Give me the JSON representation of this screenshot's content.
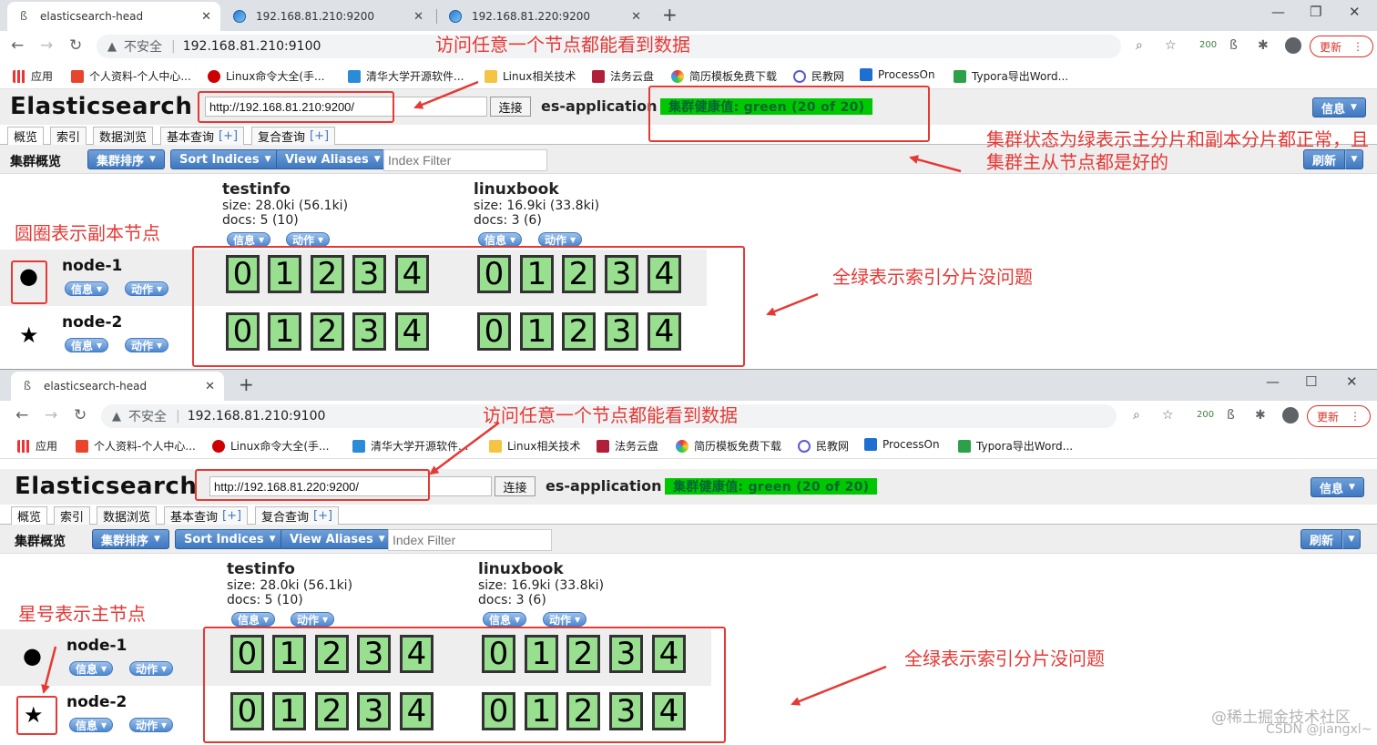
{
  "browser1": {
    "tabs": [
      {
        "title": "elasticsearch-head"
      },
      {
        "title": "192.168.81.210:9200"
      },
      {
        "title": "192.168.81.220:9200"
      }
    ],
    "address": {
      "insecure": "不安全",
      "url": "192.168.81.210:9100"
    },
    "badge": "200",
    "update": "更新"
  },
  "browser2": {
    "tabs": [
      {
        "title": "elasticsearch-head"
      }
    ],
    "address": {
      "insecure": "不安全",
      "url": "192.168.81.210:9100"
    },
    "badge": "200",
    "update": "更新"
  },
  "bookmarks": [
    "应用",
    "个人资料-个人中心...",
    "Linux命令大全(手...",
    "清华大学开源软件...",
    "Linux相关技术",
    "法务云盘",
    "简历模板免费下载",
    "民教网",
    "ProcessOn",
    "Typora导出Word..."
  ],
  "es1": {
    "logo": "Elasticsearch",
    "connect_url": "http://192.168.81.210:9200/",
    "connect_label": "连接",
    "cluster_name": "es-application",
    "health": "集群健康值: green (20 of 20)",
    "info_btn": "信息",
    "tabs": [
      "概览",
      "索引",
      "数据浏览",
      "基本查询",
      "复合查询"
    ],
    "tab_plus": "[+]",
    "sub_title": "集群概览",
    "sort_cluster": "集群排序",
    "sort_indices": "Sort Indices",
    "view_aliases": "View Aliases",
    "index_filter_placeholder": "Index Filter",
    "refresh": "刷新",
    "indices": [
      {
        "name": "testinfo",
        "size": "size: 28.0ki (56.1ki)",
        "docs": "docs: 5 (10)"
      },
      {
        "name": "linuxbook",
        "size": "size: 16.9ki (33.8ki)",
        "docs": "docs: 3 (6)"
      }
    ],
    "info_mini": "信息",
    "action_mini": "动作",
    "nodes": [
      {
        "name": "node-1",
        "icon": "circle-icon",
        "symbol": "●"
      },
      {
        "name": "node-2",
        "icon": "star-icon",
        "symbol": "★"
      }
    ],
    "shards": [
      "0",
      "1",
      "2",
      "3",
      "4"
    ]
  },
  "es2": {
    "logo": "Elasticsearch",
    "connect_url": "http://192.168.81.220:9200/",
    "connect_label": "连接",
    "cluster_name": "es-application",
    "health": "集群健康值: green (20 of 20)",
    "info_btn": "信息",
    "tabs": [
      "概览",
      "索引",
      "数据浏览",
      "基本查询",
      "复合查询"
    ],
    "tab_plus": "[+]",
    "sub_title": "集群概览",
    "sort_cluster": "集群排序",
    "sort_indices": "Sort Indices",
    "view_aliases": "View Aliases",
    "index_filter_placeholder": "Index Filter",
    "refresh": "刷新",
    "indices": [
      {
        "name": "testinfo",
        "size": "size: 28.0ki (56.1ki)",
        "docs": "docs: 5 (10)"
      },
      {
        "name": "linuxbook",
        "size": "size: 16.9ki (33.8ki)",
        "docs": "docs: 3 (6)"
      }
    ],
    "info_mini": "信息",
    "action_mini": "动作",
    "nodes": [
      {
        "name": "node-1",
        "icon": "circle-icon",
        "symbol": "●"
      },
      {
        "name": "node-2",
        "icon": "star-icon",
        "symbol": "★"
      }
    ],
    "shards": [
      "0",
      "1",
      "2",
      "3",
      "4"
    ]
  },
  "annotations": {
    "access_any_node_1": "访问任意一个节点都能看到数据",
    "access_any_node_2": "访问任意一个节点都能看到数据",
    "cluster_status_line1": "集群状态为绿表示主分片和副本分片都正常，且",
    "cluster_status_line2": "集群主从节点都是好的",
    "circle_replica": "圆圈表示副本节点",
    "star_master": "星号表示主节点",
    "all_green_1": "全绿表示索引分片没问题",
    "all_green_2": "全绿表示索引分片没问题"
  },
  "watermark": {
    "line1": "@稀土掘金技术社区",
    "line2": "CSDN @jiangxl~"
  },
  "colors": {
    "health_green": "#00c800",
    "shard_green": "#98e08f",
    "annotation_red": "#e53935",
    "es_blue": "#3f78c1"
  }
}
